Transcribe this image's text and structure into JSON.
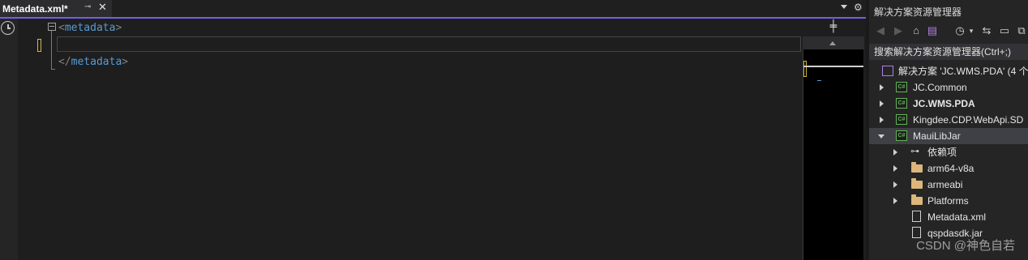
{
  "editor": {
    "tab": {
      "title": "Metadata.xml*",
      "pin_icon": "pin-icon",
      "close_icon": "close-icon"
    },
    "tab_menu_icon": "dropdown-icon",
    "settings_icon": "gear-icon",
    "gutter_icon": "history-clock-icon",
    "code_lines": [
      {
        "bracket_open": "<",
        "tag": "metadata",
        "bracket_close": ">"
      },
      {
        "text": ""
      },
      {
        "bracket_open": "</",
        "tag": "metadata",
        "bracket_close": ">"
      }
    ],
    "split_icon": "split-window-icon",
    "colors": {
      "accent": "#7160e8",
      "tag": "#569cd6",
      "bracket": "#808080",
      "change_marker": "#d7ba33"
    }
  },
  "solution_explorer": {
    "title": "解决方案资源管理器",
    "toolbar_icons": [
      "back-icon",
      "forward-icon",
      "home-icon",
      "switch-views-icon",
      "history-icon",
      "dropdown-icon",
      "sync-icon",
      "collapse-all-icon",
      "show-all-files-icon"
    ],
    "search_placeholder": "搜索解决方案资源管理器(Ctrl+;)",
    "tree": [
      {
        "label": "解决方案 'JC.WMS.PDA' (4 个",
        "icon": "solution-icon",
        "level": 0,
        "expander": "none"
      },
      {
        "label": "JC.Common",
        "icon": "csharp-project-icon",
        "level": 1,
        "expander": "collapsed"
      },
      {
        "label": "JC.WMS.PDA",
        "icon": "csharp-project-icon",
        "level": 1,
        "expander": "collapsed",
        "bold": true
      },
      {
        "label": "Kingdee.CDP.WebApi.SD",
        "icon": "csharp-project-icon",
        "level": 1,
        "expander": "collapsed"
      },
      {
        "label": "MauiLibJar",
        "icon": "csharp-project-icon",
        "level": 1,
        "expander": "expanded",
        "selected": true
      },
      {
        "label": "依赖项",
        "icon": "dependencies-icon",
        "level": 2,
        "expander": "collapsed"
      },
      {
        "label": "arm64-v8a",
        "icon": "folder-icon",
        "level": 2,
        "expander": "collapsed"
      },
      {
        "label": "armeabi",
        "icon": "folder-icon",
        "level": 2,
        "expander": "collapsed"
      },
      {
        "label": "Platforms",
        "icon": "folder-icon",
        "level": 2,
        "expander": "collapsed"
      },
      {
        "label": "Metadata.xml",
        "icon": "xml-file-icon",
        "level": 2,
        "expander": "none"
      },
      {
        "label": "qspdasdk.jar",
        "icon": "jar-file-icon",
        "level": 2,
        "expander": "none"
      }
    ]
  },
  "watermark": "CSDN @神色自若"
}
